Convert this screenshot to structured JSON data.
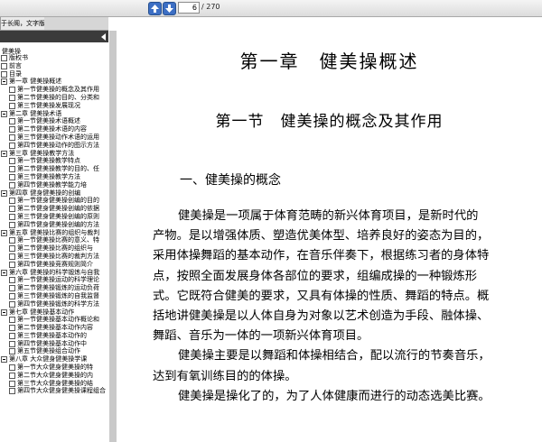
{
  "toolbar": {
    "page_value": "6",
    "page_total": "/ 270"
  },
  "tab": {
    "label": "于长阁，文字版"
  },
  "sidebar": {
    "root": "健美操",
    "items": [
      {
        "level": 0,
        "label": "版权书"
      },
      {
        "level": 0,
        "label": "前言"
      },
      {
        "level": 0,
        "label": "目录"
      },
      {
        "level": 0,
        "label": "第一章 健美操概述",
        "open": true
      },
      {
        "level": 1,
        "label": "第一节健美操的概念及其作用"
      },
      {
        "level": 1,
        "label": "第二节健美操的目的、分类和"
      },
      {
        "level": 1,
        "label": "第三节健美操发展现况"
      },
      {
        "level": 0,
        "label": "第二章 健美操术语",
        "open": true
      },
      {
        "level": 1,
        "label": "第一节健美操术语概述"
      },
      {
        "level": 1,
        "label": "第二节健美操术语的内容"
      },
      {
        "level": 1,
        "label": "第三节健美操动作术语的运用"
      },
      {
        "level": 1,
        "label": "第四节健美操动作的图示方法"
      },
      {
        "level": 0,
        "label": "第三章 健美操教学方法",
        "open": true
      },
      {
        "level": 1,
        "label": "第一节健美操教学特点"
      },
      {
        "level": 1,
        "label": "第二节健美操教学的目的、任"
      },
      {
        "level": 1,
        "label": "第三节健美操教学方法"
      },
      {
        "level": 1,
        "label": "第四节健美操教学能力培"
      },
      {
        "level": 0,
        "label": "第四章 健身健美操的创编",
        "open": true
      },
      {
        "level": 1,
        "label": "第一节健身健美操创编的目的"
      },
      {
        "level": 1,
        "label": "第二节健身健美操创编的依据"
      },
      {
        "level": 1,
        "label": "第三节健身健美操创编的原则"
      },
      {
        "level": 1,
        "label": "第四节健身健美操创编的方法"
      },
      {
        "level": 0,
        "label": "第五章 健美操比赛的组织与裁判",
        "open": true
      },
      {
        "level": 1,
        "label": "第一节健美操比赛的意义、特"
      },
      {
        "level": 1,
        "label": "第二节健美操比赛的组织与"
      },
      {
        "level": 1,
        "label": "第三节健美操比赛的裁判方法"
      },
      {
        "level": 1,
        "label": "第四节健美操竞赛规则简介"
      },
      {
        "level": 0,
        "label": "第六章 健美操的科学锻炼与自我",
        "open": true
      },
      {
        "level": 1,
        "label": "第一节健美操运动的科学理论"
      },
      {
        "level": 1,
        "label": "第二节健美操锻炼的运动负荷"
      },
      {
        "level": 1,
        "label": "第三节健美操锻炼的自我监督"
      },
      {
        "level": 1,
        "label": "第四节健美操锻炼的科学方法"
      },
      {
        "level": 0,
        "label": "第七章 健美操基本动作",
        "open": true
      },
      {
        "level": 1,
        "label": "第一节健美操基本动作概论和"
      },
      {
        "level": 1,
        "label": "第二节健美操基本动作内容"
      },
      {
        "level": 1,
        "label": "第三节健美操基本动作的"
      },
      {
        "level": 1,
        "label": "第四节健美操基本动作中"
      },
      {
        "level": 1,
        "label": "第五节健美操组合动作"
      },
      {
        "level": 0,
        "label": "第八章 大众健身健美操学课",
        "open": true
      },
      {
        "level": 1,
        "label": "第一节大众健身健美操的特"
      },
      {
        "level": 1,
        "label": "第二节大众健身健美操的内"
      },
      {
        "level": 1,
        "label": "第三节大众健身健美操的结"
      },
      {
        "level": 1,
        "label": "第四节大众健身健美操课程组合"
      }
    ]
  },
  "document": {
    "chapter_title": "第一章　健美操概述",
    "section_title": "第一节　健美操的概念及其作用",
    "subheading": "一、健美操的概念",
    "lines": [
      {
        "text": "健美操是一项属于体育范畴的新兴体育项目，是新时代的",
        "indent": true
      },
      {
        "text": "产物。是以增强体质、塑造优美体型、培养良好的姿态为目的，",
        "indent": false
      },
      {
        "text": "采用体操舞蹈的基本动作，在音乐伴奏下，根据练习者的身体特",
        "indent": false
      },
      {
        "text": "点，按照全面发展身体各部位的要求，组编成操的一种锻炼形",
        "indent": false
      },
      {
        "text": "式。它既符合健美的要求，又具有体操的性质、舞蹈的特点。概",
        "indent": false
      },
      {
        "text": "括地讲健美操是以人体自身为对象以艺术创造为手段、融体操、",
        "indent": false
      },
      {
        "text": "舞蹈、音乐为一体的一项新兴体育项目。",
        "indent": false
      },
      {
        "text": "健美操主要是以舞蹈和体操相结合，配以流行的节奏音乐，",
        "indent": true
      },
      {
        "text": "达到有氧训练目的的体操。",
        "indent": false
      },
      {
        "text": "健美操是操化了的，为了人体健康而进行的动态选美比赛。",
        "indent": true
      }
    ]
  }
}
